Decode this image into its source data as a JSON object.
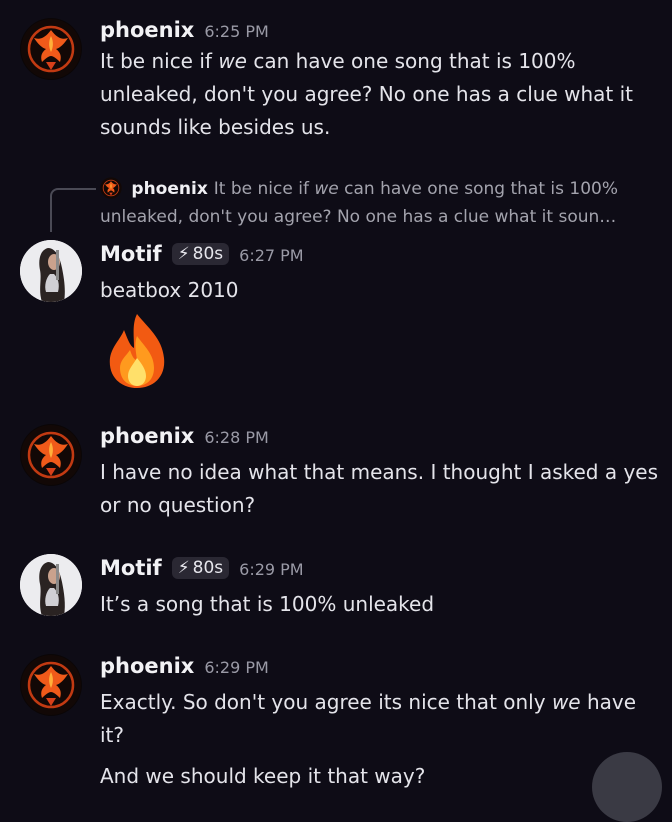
{
  "messages": [
    {
      "user": "phoenix",
      "time": "6:25 PM",
      "lines": [
        {
          "pre": "It be nice if ",
          "em": "we",
          "post": " can have one song that is 100% unleaked, don't you agree? No one has a clue what it sounds like besides us."
        }
      ]
    },
    {
      "reply": {
        "user": "phoenix",
        "pre": "It be nice if ",
        "em": "we",
        "post": " can have one song that is 100% unleaked, don't you agree? No one has a clue what it soun…"
      },
      "user": "Motif",
      "tag": "80s",
      "time": "6:27 PM",
      "text": "beatbox 2010",
      "emoji": "🔥"
    },
    {
      "user": "phoenix",
      "time": "6:28 PM",
      "text": "I have no idea what that means. I thought I asked a yes or no question?"
    },
    {
      "user": "Motif",
      "tag": "80s",
      "time": "6:29 PM",
      "text": "It’s a song that is 100% unleaked"
    },
    {
      "user": "phoenix",
      "time": "6:29 PM",
      "lines": [
        {
          "pre": "Exactly. So don't you agree its nice that only ",
          "em": "we",
          "post": " have it?"
        },
        {
          "pre": "And we should keep it that way?",
          "em": "",
          "post": ""
        }
      ]
    }
  ],
  "icons": {
    "phoenix_avatar": "phoenix-logo-icon",
    "motif_avatar": "profile-photo",
    "tag_icon": "lightning-icon",
    "reaction": "fire-emoji"
  },
  "colors": {
    "background": "#0e0c16",
    "phoenix_orange": "#e8561a",
    "tag_bg": "#2a2833"
  }
}
